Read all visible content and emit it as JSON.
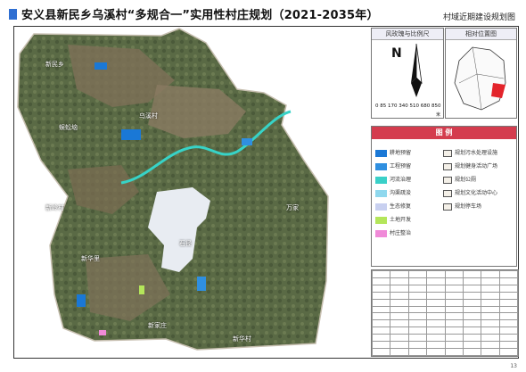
{
  "header": {
    "title": "安义县新民乡乌溪村“多规合一”实用性村庄规划（2021-2035年）",
    "subtitle": "村域近期建设规划图"
  },
  "map": {
    "place_labels": [
      "新民乡",
      "蜈蚣垴",
      "乌溪村",
      "万家",
      "新华村",
      "新岭村",
      "石径",
      "新家庄",
      "新华里"
    ]
  },
  "compass": {
    "header": "风玫瑰与比例尺",
    "north": "N",
    "scale_ticks": "0 85 170 340 510 680 850",
    "scale_unit": "米"
  },
  "locator": {
    "header": "相对位置图"
  },
  "legend": {
    "title": "图 例",
    "items": [
      {
        "label": "耕地预留",
        "color": "#1a78d6"
      },
      {
        "label": "工程预留",
        "color": "#2f8fe0"
      },
      {
        "label": "河流治理",
        "color": "#3ad0c8"
      },
      {
        "label": "沟渠疏浚",
        "color": "#8fd8ee"
      },
      {
        "label": "生态修复",
        "color": "#c8d0f0"
      },
      {
        "label": "土地开发",
        "color": "#b4e65a"
      },
      {
        "label": "村庄整治",
        "color": "#f08ad8"
      }
    ],
    "symbols": [
      {
        "label": "规划污水处理设施"
      },
      {
        "label": "规划健身活动广场"
      },
      {
        "label": "规划公厕"
      },
      {
        "label": "规划文化活动中心"
      },
      {
        "label": "规划停车场"
      }
    ]
  },
  "page": {
    "number": "13"
  }
}
